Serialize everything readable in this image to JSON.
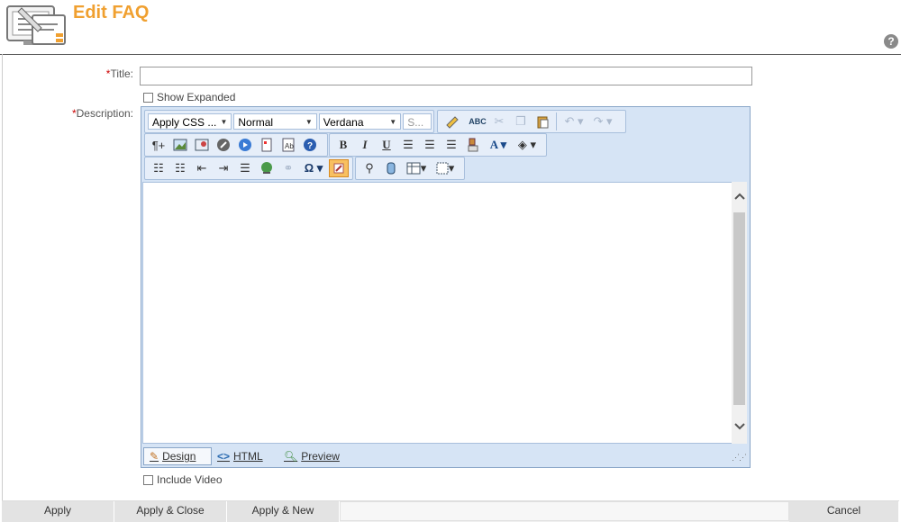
{
  "header": {
    "title": "Edit FAQ"
  },
  "form": {
    "title": {
      "required_mark": "*",
      "label": "Title:",
      "value": ""
    },
    "show_expanded": {
      "label": "Show Expanded",
      "checked": false
    },
    "description": {
      "required_mark": "*",
      "label": "Description:"
    },
    "include_video": {
      "label": "Include Video",
      "checked": false
    }
  },
  "editor": {
    "css_class": "Apply CSS ...",
    "paragraph": "Normal",
    "font": "Verdana",
    "size": "S...",
    "modes": {
      "design": "Design",
      "html": "HTML",
      "preview": "Preview"
    }
  },
  "actions": {
    "apply": "Apply",
    "apply_close": "Apply & Close",
    "apply_new": "Apply & New",
    "cancel": "Cancel"
  },
  "colors": {
    "title": "#f0a030",
    "required": "#cc0000",
    "editor_bg": "#d6e4f5",
    "highlight": "#f8c060"
  },
  "icons": [
    "app-icon",
    "help-icon",
    "paragraph-icon",
    "image-icon",
    "image-map-icon",
    "flash-icon",
    "media-icon",
    "document-icon",
    "template-icon",
    "help-icon",
    "bold-icon",
    "italic-icon",
    "underline-icon",
    "align-left-icon",
    "align-center-icon",
    "align-right-icon",
    "format-stripper-icon",
    "font-color-icon",
    "background-color-icon",
    "ordered-list-icon",
    "unordered-list-icon",
    "outdent-icon",
    "indent-icon",
    "justify-icon",
    "hyperlink-icon",
    "remove-link-icon",
    "symbol-icon",
    "track-changes-icon",
    "find-icon",
    "spellcheck-icon",
    "cut-icon",
    "copy-icon",
    "paste-icon",
    "undo-icon",
    "redo-icon",
    "table-icon",
    "module-icon"
  ]
}
